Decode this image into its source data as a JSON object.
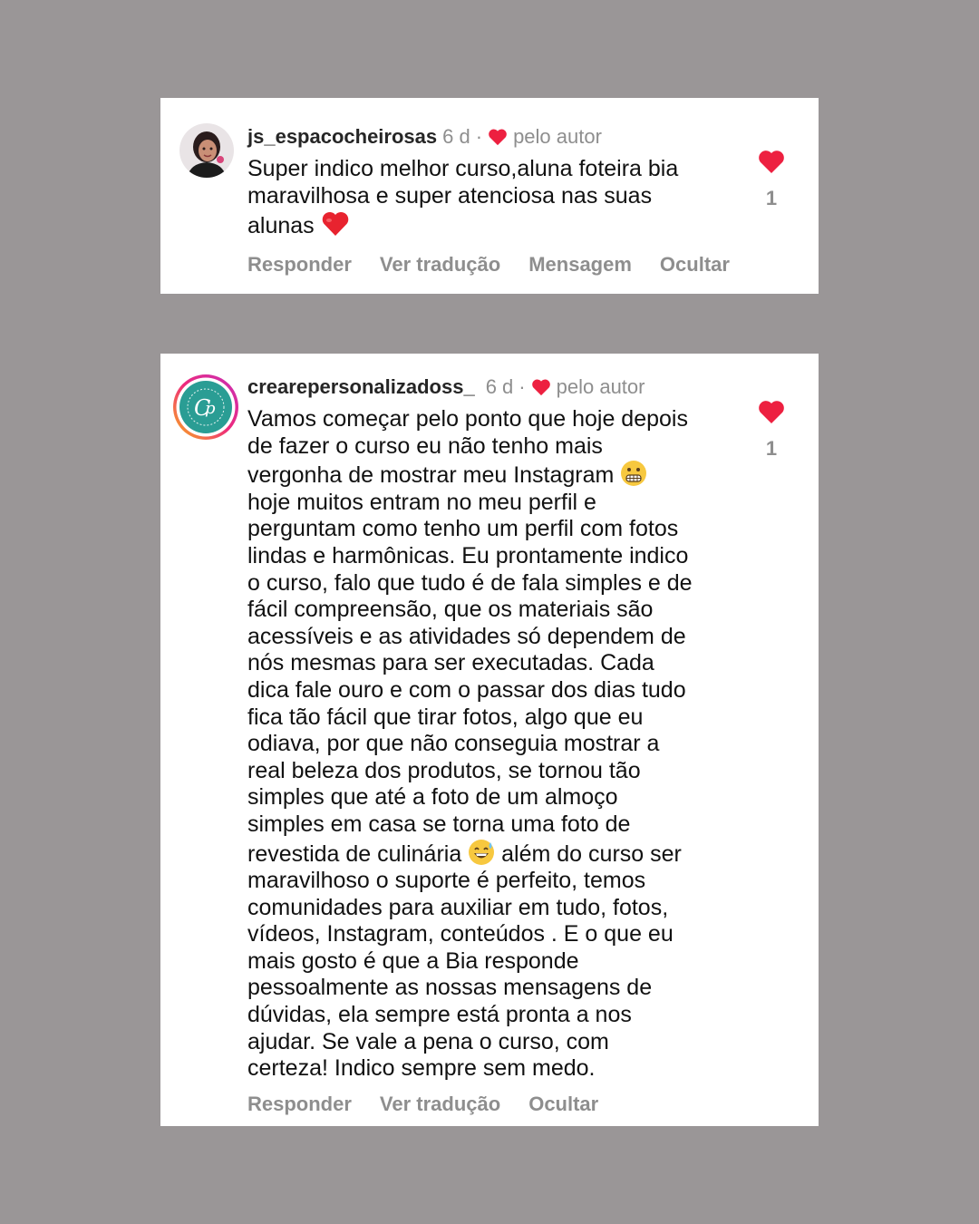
{
  "comments": [
    {
      "username": "js_espacocheirosas",
      "time": "6 d",
      "separator": "·",
      "liked_by_author": "pelo autor",
      "text_before_emoji": "Super indico melhor curso,aluna foteira bia\nmaravilhosa e super atenciosa nas suas\nalunas ",
      "like_count": "1",
      "actions": [
        "Responder",
        "Ver tradução",
        "Mensagem",
        "Ocultar"
      ]
    },
    {
      "username": "crearepersonalizadoss_",
      "time": "6 d",
      "separator": "·",
      "liked_by_author": "pelo autor",
      "text_part1": "Vamos começar pelo ponto que hoje depois\nde fazer o curso eu não tenho mais\nvergonha de mostrar meu Instagram ",
      "text_part2": "\nhoje muitos entram no meu perfil e\nperguntam como tenho um perfil com fotos\nlindas e harmônicas. Eu prontamente indico\no curso, falo que tudo é de fala simples e de\nfácil compreensão, que os materiais são\nacessíveis e as atividades só dependem de\nnós mesmas para ser executadas.  Cada\ndica fale ouro e com o passar dos dias tudo\nfica tão fácil que tirar fotos, algo que eu\nodiava, por que não conseguia mostrar a\nreal beleza  dos produtos, se tornou tão\nsimples que até a foto de um almoço\nsimples em casa se torna uma foto de\nrevestida de culinária ",
      "text_part3": " além do curso ser\nmaravilhoso o suporte é perfeito, temos\ncomunidades para auxiliar em tudo, fotos,\nvídeos, Instagram, conteúdos . E o que eu\nmais gosto é que a Bia responde\npessoalmente as nossas mensagens de\ndúvidas, ela sempre está pronta a nos\najudar.  Se vale a pena o curso, com\ncerteza! Indico sempre sem medo.",
      "like_count": "1",
      "actions": [
        "Responder",
        "Ver tradução",
        "Ocultar"
      ]
    }
  ],
  "icons": {
    "liked_heart": "heart-icon",
    "like_button": "heart-icon",
    "emoji_1": "red-heart-emoji",
    "emoji_2": "grimacing-face-emoji",
    "emoji_3": "grinning-sweat-emoji"
  },
  "colors": {
    "background": "#9a9697",
    "card": "#ffffff",
    "heart": "#ed2040",
    "username": "#262626",
    "secondary_text": "#8e8e8e"
  }
}
